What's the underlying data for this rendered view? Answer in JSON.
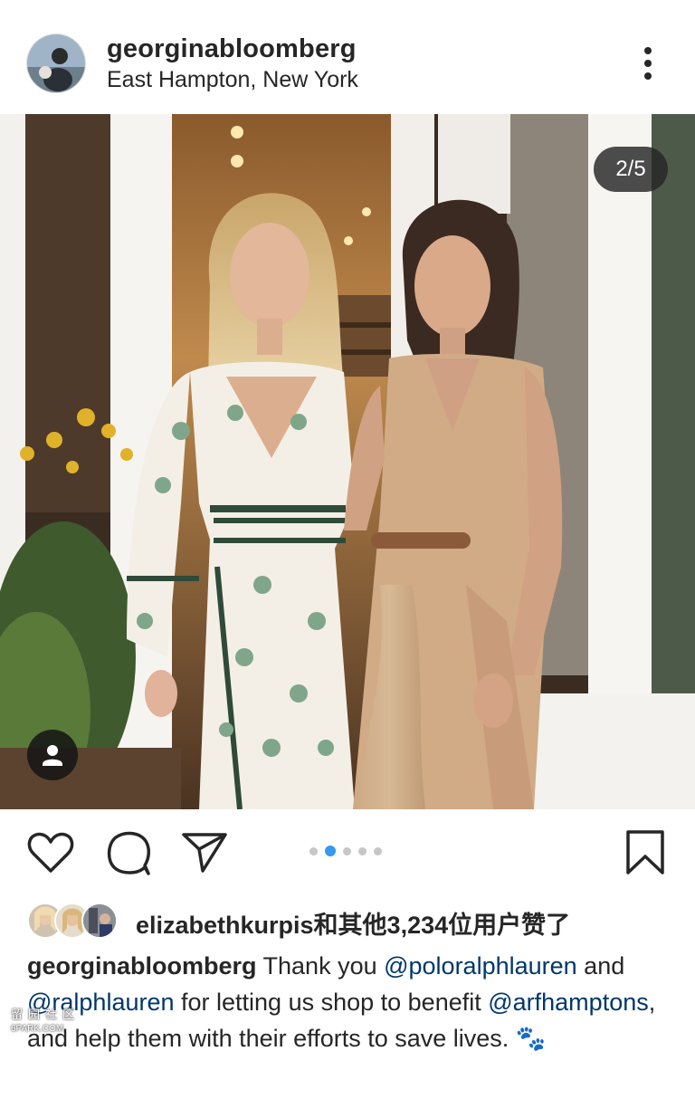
{
  "post": {
    "username": "georginabloomberg",
    "location": "East Hampton, New York",
    "more_icon": "more-vertical-icon"
  },
  "photo": {
    "counter": "2/5",
    "tag_icon": "user-tag-icon"
  },
  "actions": {
    "like_icon": "heart-icon",
    "comment_icon": "comment-icon",
    "share_icon": "send-icon",
    "save_icon": "bookmark-icon",
    "carousel_total": 5,
    "carousel_active": 2,
    "accent_color": "#3897f0"
  },
  "likes": {
    "text": "elizabethkurpis和其他3,234位用户赞了"
  },
  "caption": {
    "username": "georginabloomberg",
    "t1": " Thank you ",
    "m1": "@poloralphlauren",
    "t2": " and ",
    "m2": "@ralphlauren",
    "t3": " for letting us shop to benefit ",
    "m3": "@arfhamptons",
    "t4": ", and help them with their efforts to save lives. ",
    "emoji": "🐾"
  },
  "watermark": {
    "text": "留园社区",
    "url": "6PARK.COM"
  }
}
